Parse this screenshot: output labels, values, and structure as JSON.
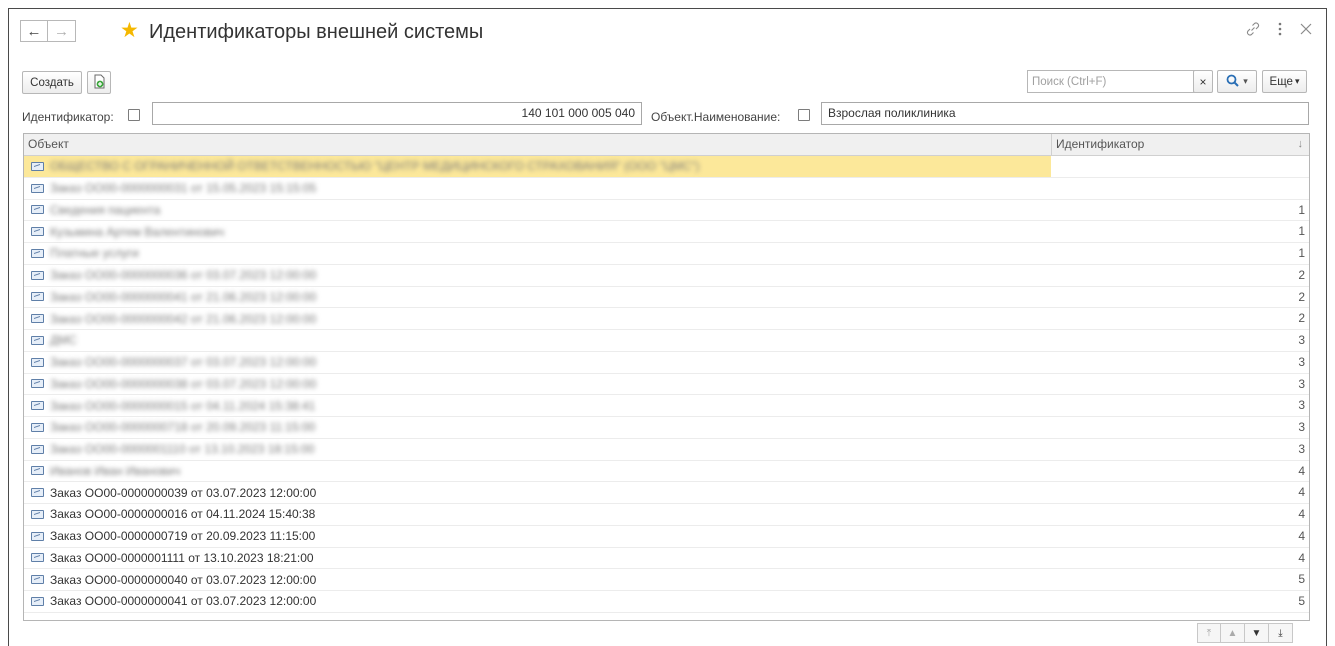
{
  "window": {
    "title": "Идентификаторы внешней системы"
  },
  "nav": {
    "back": "←",
    "forward": "→"
  },
  "toolbar": {
    "create_label": "Создать",
    "search_placeholder": "Поиск (Ctrl+F)",
    "clear_label": "×",
    "more_label": "Еще",
    "more_caret": "▾",
    "search_caret": "▾"
  },
  "filters": {
    "identifier_label": "Идентификатор:",
    "identifier_value": "140 101 000 005 040",
    "name_label": "Объект.Наименование:",
    "name_value": "Взрослая поликлиника"
  },
  "table": {
    "columns": [
      "Объект",
      "Идентификатор"
    ],
    "sort_indicator": "↓",
    "rows": [
      {
        "object": "ОБЩЕСТВО С ОГРАНИЧЕННОЙ ОТВЕТСТВЕННОСТЬЮ \"ЦЕНТР МЕДИЦИНСКОГО СТРАХОВАНИЯ\" (ООО \"ЦМС\")",
        "id": "",
        "blurred": true,
        "selected": true
      },
      {
        "object": "Заказ ОО00-0000000031 от 15.05.2023 15:15:05",
        "id": "",
        "blurred": true
      },
      {
        "object": "Сведения пациента",
        "id": "1",
        "blurred": true
      },
      {
        "object": "Кузьмина Артем Валентинович",
        "id": "1",
        "blurred": true
      },
      {
        "object": "Платные услуги",
        "id": "1",
        "blurred": true
      },
      {
        "object": "Заказ ОО00-0000000036 от 03.07.2023 12:00:00",
        "id": "2",
        "blurred": true
      },
      {
        "object": "Заказ ОО00-0000000041 от 21.06.2023 12:00:00",
        "id": "2",
        "blurred": true
      },
      {
        "object": "Заказ ОО00-0000000042 от 21.06.2023 12:00:00",
        "id": "2",
        "blurred": true
      },
      {
        "object": "ДМС",
        "id": "3",
        "blurred": true
      },
      {
        "object": "Заказ ОО00-0000000037 от 03.07.2023 12:00:00",
        "id": "3",
        "blurred": true
      },
      {
        "object": "Заказ ОО00-0000000038 от 03.07.2023 12:00:00",
        "id": "3",
        "blurred": true
      },
      {
        "object": "Заказ ОО00-0000000015 от 04.11.2024 15:38:41",
        "id": "3",
        "blurred": true
      },
      {
        "object": "Заказ ОО00-0000000718 от 20.09.2023 11:15:00",
        "id": "3",
        "blurred": true
      },
      {
        "object": "Заказ ОО00-0000001110 от 13.10.2023 18:15:00",
        "id": "3",
        "blurred": true
      },
      {
        "object": "Иванов Иван Иванович",
        "id": "4",
        "blurred": true
      },
      {
        "object": "Заказ ОО00-0000000039 от 03.07.2023 12:00:00",
        "id": "4"
      },
      {
        "object": "Заказ ОО00-0000000016 от 04.11.2024 15:40:38",
        "id": "4"
      },
      {
        "object": "Заказ ОО00-0000000719 от 20.09.2023 11:15:00",
        "id": "4"
      },
      {
        "object": "Заказ ОО00-0000001111 от 13.10.2023 18:21:00",
        "id": "4"
      },
      {
        "object": "Заказ ОО00-0000000040 от 03.07.2023 12:00:00",
        "id": "5"
      },
      {
        "object": "Заказ ОО00-0000000041 от 03.07.2023 12:00:00",
        "id": "5"
      }
    ]
  },
  "pager": {
    "first": "⤒",
    "up": "▲",
    "down": "▼",
    "last": "⤓"
  },
  "colors": {
    "accent_star": "#f5b800",
    "selected_row": "#fce89a",
    "search_icon": "#2a6fb5"
  },
  "icons": {
    "star": "star-icon",
    "link": "link-icon",
    "more": "more-vert-icon",
    "close": "close-icon",
    "add_copy": "add-copy-icon",
    "search": "search-icon",
    "row": "reference-item-icon"
  }
}
